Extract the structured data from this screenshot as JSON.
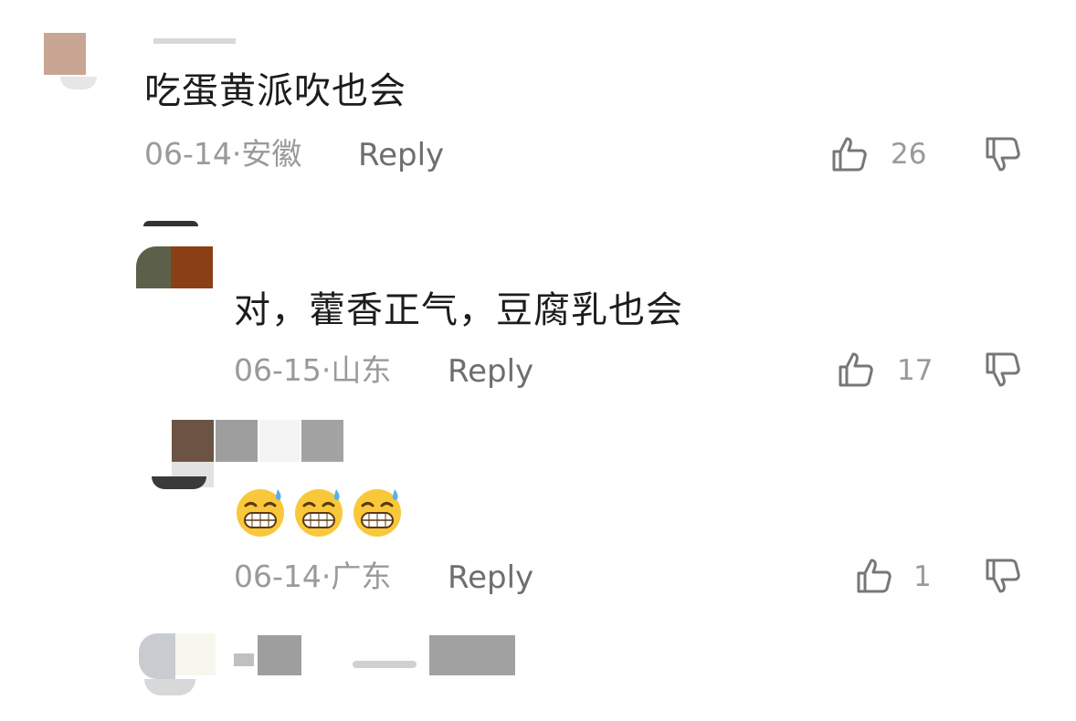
{
  "comments": [
    {
      "text": "吃蛋黄派吹也会",
      "date": "06-14·",
      "location": "安徽",
      "reply_label": "Reply",
      "like_count": "26"
    },
    {
      "text": "对，藿香正气，豆腐乳也会",
      "date": "06-15·",
      "location": "山东",
      "reply_label": "Reply",
      "like_count": "17"
    },
    {
      "emojis": [
        "grinning-sweat-emoji",
        "grinning-sweat-emoji",
        "grinning-sweat-emoji"
      ],
      "date": "06-14·",
      "location": "广东",
      "reply_label": "Reply",
      "like_count": "1"
    }
  ],
  "icons": {
    "like": "thumbs-up-icon",
    "dislike": "thumbs-down-icon"
  },
  "colors": {
    "text": "#1c1c1c",
    "meta": "#9a9a9a",
    "icon": "#777777"
  }
}
